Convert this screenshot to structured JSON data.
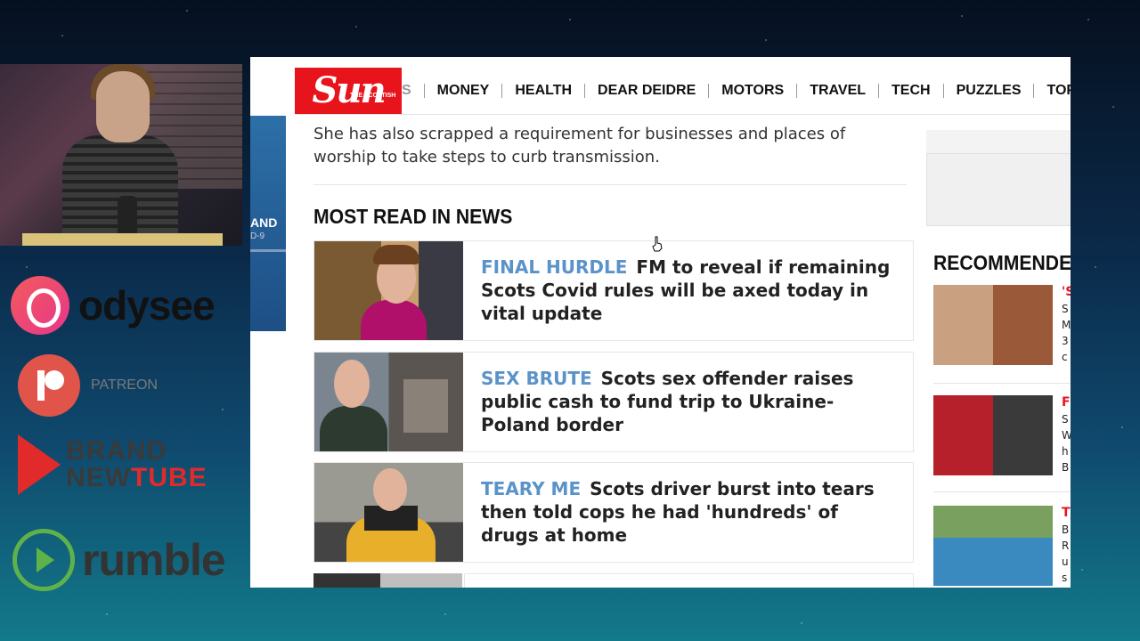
{
  "sponsors": {
    "odysee": "odysee",
    "patreon": "PATREON",
    "bnt_line1": "BRAND",
    "bnt_line2a": "NEW",
    "bnt_line2b": "TUBE",
    "rumble": "rumble"
  },
  "site": {
    "logo": "Sun",
    "logo_tag": "THE SCOTTISH",
    "nav": [
      "S",
      "MONEY",
      "HEALTH",
      "DEAR DEIDRE",
      "MOTORS",
      "TRAVEL",
      "TECH",
      "PUZZLES",
      "TOPICS A-Z"
    ]
  },
  "side_strip": {
    "text1": "AND",
    "text2": "D-9"
  },
  "article": {
    "paragraph": "She has also scrapped a requirement for businesses and places of worship to take steps to curb transmission."
  },
  "most_read": {
    "heading": "MOST READ IN NEWS",
    "items": [
      {
        "kicker": "FINAL HURDLE",
        "headline": "FM to reveal if remaining Scots Covid rules will be axed today in vital update"
      },
      {
        "kicker": "SEX BRUTE",
        "headline": "Scots sex offender raises public cash to fund trip to Ukraine-Poland border"
      },
      {
        "kicker": "TEARY ME",
        "headline": "Scots driver burst into tears then told cops he had 'hundreds' of drugs at home"
      }
    ]
  },
  "recommended": {
    "heading": "RECOMMENDED",
    "items": [
      {
        "kicker": "'S",
        "lines": [
          "S",
          "M",
          "3",
          "c"
        ]
      },
      {
        "kicker": "F",
        "lines": [
          "S",
          "W",
          "h",
          "B"
        ]
      },
      {
        "kicker": "T",
        "lines": [
          "B",
          "R",
          "u",
          "s"
        ]
      }
    ]
  },
  "colors": {
    "sun_red": "#e8141c",
    "kicker_blue": "#5b93c9"
  }
}
